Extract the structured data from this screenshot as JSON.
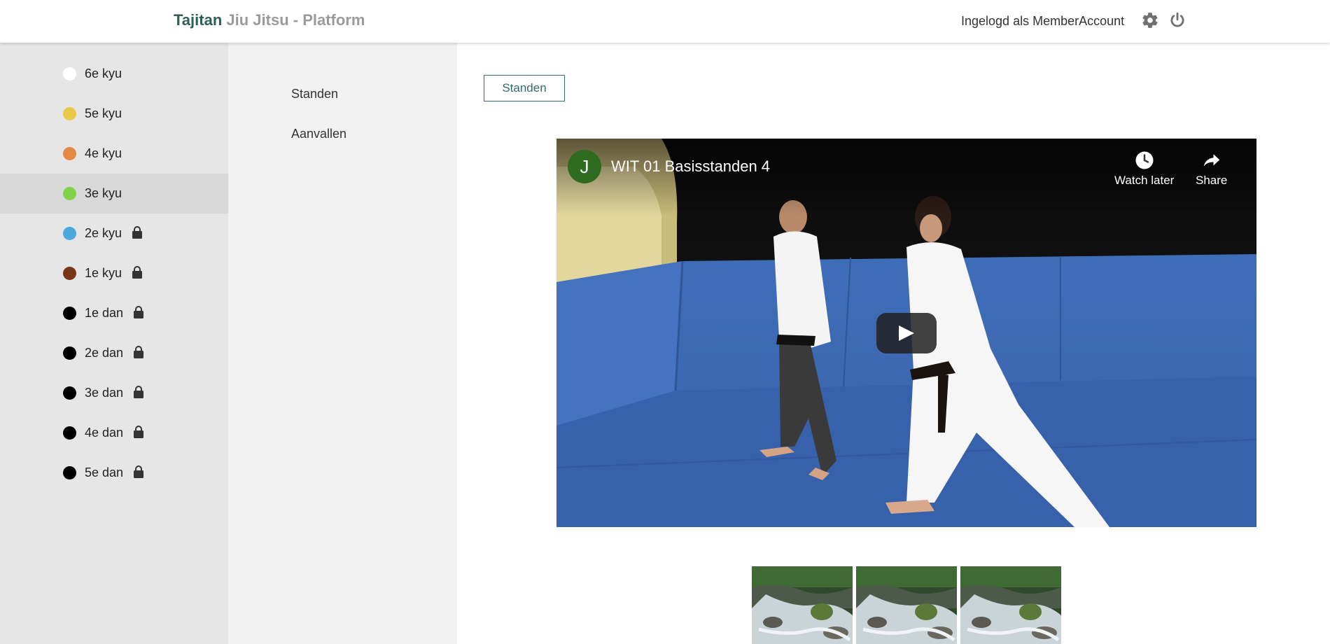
{
  "header": {
    "brand_part1": "Tajitan",
    "brand_part2": "Jiu Jitsu - Platform",
    "login_text": "Ingelogd als MemberAccount",
    "settings_icon": "gear-icon",
    "logout_icon": "power-icon"
  },
  "colors": {
    "brand_primary": "#2f5f5a",
    "brand_secondary": "#9a9a9a",
    "accent": "#2f6e66",
    "sidebar_bg": "#e6e6e6",
    "subnav_bg": "#f2f2f2"
  },
  "belts": [
    {
      "label": "6e kyu",
      "color": "#ffffff",
      "locked": false,
      "active": false
    },
    {
      "label": "5e kyu",
      "color": "#e8c94a",
      "locked": false,
      "active": false
    },
    {
      "label": "4e kyu",
      "color": "#e48a45",
      "locked": false,
      "active": false
    },
    {
      "label": "3e kyu",
      "color": "#82d14b",
      "locked": false,
      "active": true
    },
    {
      "label": "2e kyu",
      "color": "#4aa8dc",
      "locked": true,
      "active": false
    },
    {
      "label": "1e kyu",
      "color": "#7a3516",
      "locked": true,
      "active": false
    },
    {
      "label": "1e dan",
      "color": "#000000",
      "locked": true,
      "active": false
    },
    {
      "label": "2e dan",
      "color": "#000000",
      "locked": true,
      "active": false
    },
    {
      "label": "3e dan",
      "color": "#000000",
      "locked": true,
      "active": false
    },
    {
      "label": "4e dan",
      "color": "#000000",
      "locked": true,
      "active": false
    },
    {
      "label": "5e dan",
      "color": "#000000",
      "locked": true,
      "active": false
    }
  ],
  "subnav": {
    "items": [
      "Standen",
      "Aanvallen"
    ]
  },
  "main": {
    "tab_label": "Standen",
    "video": {
      "channel_initial": "J",
      "title": "WIT 01 Basisstanden 4",
      "watch_later": "Watch later",
      "share": "Share"
    },
    "thumbnails": [
      "thumbnail-waterfall",
      "thumbnail-waterfall",
      "thumbnail-waterfall"
    ]
  }
}
